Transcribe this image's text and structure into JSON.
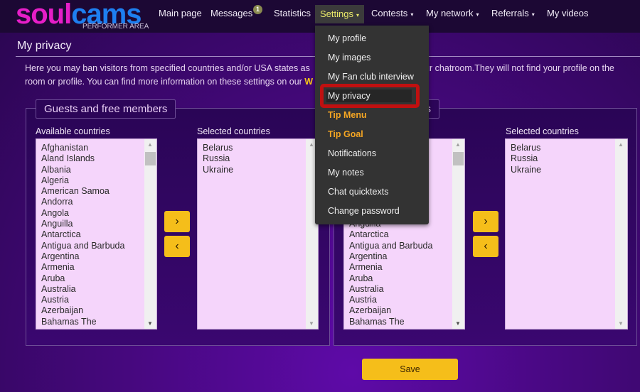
{
  "header": {
    "logo": {
      "part1": "soul",
      "part2": "cams",
      "sub": "PERFORMER AREA"
    },
    "nav": [
      {
        "label": "Main page"
      },
      {
        "label": "Messages",
        "badge": "1"
      },
      {
        "label": "Statistics"
      },
      {
        "label": "Settings",
        "caret": "▾",
        "active": true
      },
      {
        "label": "Contests",
        "caret": "▾"
      },
      {
        "label": "My network",
        "caret": "▾"
      },
      {
        "label": "Referrals",
        "caret": "▾"
      },
      {
        "label": "My videos"
      }
    ]
  },
  "page": {
    "title": "My privacy",
    "intro1a": "Here you may ban visitors from specified countries and/or USA states as",
    "intro1b": "m your chatroom.They will not find your profile on the",
    "intro2": "room or profile. You can find more information on these settings on our ",
    "intro2_link": "W"
  },
  "panels": [
    {
      "legend": "Guests and free members",
      "available_label": "Available countries",
      "selected_label": "Selected countries"
    },
    {
      "legend": "s",
      "available_label": "",
      "selected_label": "Selected countries"
    }
  ],
  "available": [
    "Afghanistan",
    "Aland Islands",
    "Albania",
    "Algeria",
    "American Samoa",
    "Andorra",
    "Angola",
    "Anguilla",
    "Antarctica",
    "Antigua and Barbuda",
    "Argentina",
    "Armenia",
    "Aruba",
    "Australia",
    "Austria",
    "Azerbaijan",
    "Bahamas The"
  ],
  "selected": [
    "Belarus",
    "Russia",
    "Ukraine"
  ],
  "buttons": {
    "add": "›",
    "remove": "‹",
    "save": "Save"
  },
  "menu": {
    "items": [
      {
        "label": "My profile"
      },
      {
        "label": "My images"
      },
      {
        "label": "My Fan club interview"
      },
      {
        "label": "My privacy",
        "highlighted": true
      },
      {
        "label": "Tip Menu",
        "accent": true
      },
      {
        "label": "Tip Goal",
        "accent": true
      },
      {
        "label": "Notifications"
      },
      {
        "label": "My notes"
      },
      {
        "label": "Chat quicktexts"
      },
      {
        "label": "Change password"
      }
    ]
  },
  "colors": {
    "accent": "#f5be1a",
    "highlight": "#c01010",
    "list_bg": "#f5d5fb"
  }
}
